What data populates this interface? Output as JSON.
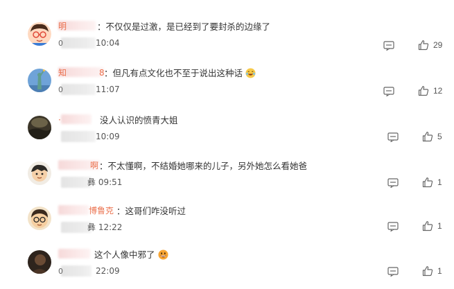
{
  "comments": [
    {
      "name_frag_left": "明",
      "name_frag_right": "",
      "text": "：不仅仅是过激，是已经到了要封杀的边缘了",
      "date_prefix": "0",
      "time": "10:04",
      "likes": "29",
      "avatar_icon": "cartoon-boy-avatar",
      "emoji": ""
    },
    {
      "name_frag_left": "知",
      "name_frag_right": "8",
      "text": "：但凡有点文化也不至于说出这种话",
      "date_prefix": "0",
      "time": "11:07",
      "likes": "12",
      "avatar_icon": "statue-of-liberty-avatar",
      "emoji": "laughing-emoji"
    },
    {
      "name_frag_left": "·",
      "name_frag_right": "",
      "text": "没人认识的愤青大姐",
      "date_prefix": "",
      "time": "10:09",
      "likes": "5",
      "avatar_icon": "dark-landscape-avatar",
      "emoji": ""
    },
    {
      "name_frag_left": "",
      "name_frag_right": "啊",
      "text": "：不太懂啊，不结婚她哪来的儿子，另外她怎么看她爸",
      "date_prefix": "",
      "time": "彝 09:51",
      "likes": "1",
      "avatar_icon": "cartoon-character-avatar",
      "emoji": ""
    },
    {
      "name_frag_left": "",
      "name_frag_right": "博鲁克",
      "text": "：这哥们咋没听过",
      "date_prefix": "",
      "time": "彝 12:22",
      "likes": "1",
      "avatar_icon": "cartoon-face-avatar",
      "emoji": ""
    },
    {
      "name_frag_left": "",
      "name_frag_right": "",
      "text": "这个人像中邪了",
      "date_prefix": "0",
      "time": "22:09",
      "likes": "1",
      "avatar_icon": "dark-photo-avatar",
      "emoji": "grinning-emoji"
    }
  ],
  "colors": {
    "name_accent": "#eb7350",
    "text": "#333333",
    "meta": "#555555",
    "icon": "#666666"
  }
}
